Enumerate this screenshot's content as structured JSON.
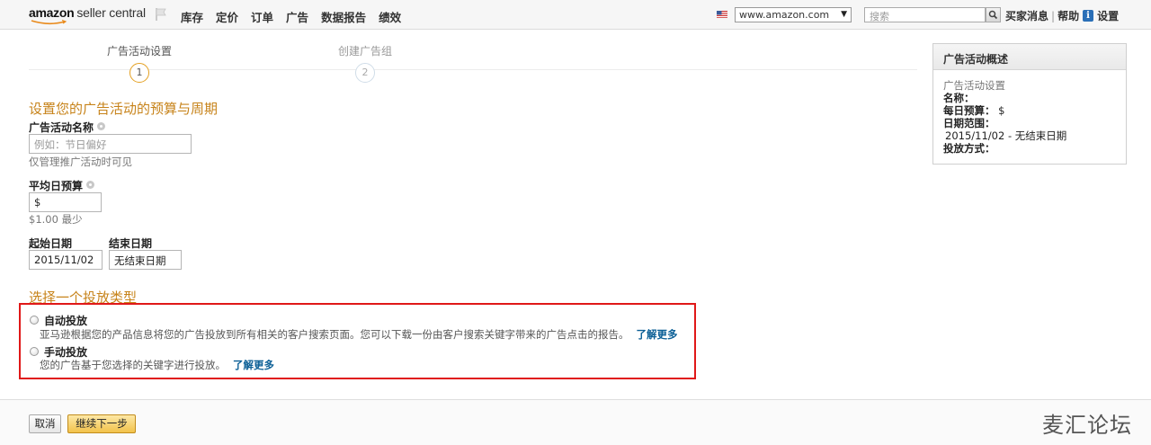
{
  "header": {
    "logo_amazon": "amazon",
    "logo_product": "seller central",
    "nav": [
      "库存",
      "定价",
      "订单",
      "广告",
      "数据报告",
      "绩效"
    ],
    "marketplace": "www.amazon.com",
    "search_placeholder": "搜索",
    "links": {
      "messages": "买家消息",
      "help": "帮助",
      "settings": "设置"
    }
  },
  "steps": [
    {
      "label": "广告活动设置",
      "number": "1"
    },
    {
      "label": "创建广告组",
      "number": "2"
    }
  ],
  "summary": {
    "title": "广告活动概述",
    "subtitle": "广告活动设置",
    "name_label": "名称：",
    "budget_label": "每日预算：",
    "budget_value": "$",
    "date_label": "日期范围：",
    "date_value": "2015/11/02 - 无结束日期",
    "targeting_label": "投放方式："
  },
  "form": {
    "section_title": "设置您的广告活动的预算与周期",
    "campaign_name_label": "广告活动名称",
    "campaign_name_placeholder": "例如：节日偏好",
    "campaign_name_hint": "仅管理推广活动时可见",
    "budget_label": "平均日预算",
    "budget_value": "$",
    "budget_hint": "$1.00 最少",
    "start_label": "起始日期",
    "start_value": "2015/11/02",
    "end_label": "结束日期",
    "end_value": "无结束日期"
  },
  "targeting": {
    "section_title": "选择一个投放类型",
    "auto_label": "自动投放",
    "auto_desc": "亚马逊根据您的产品信息将您的广告投放到所有相关的客户搜索页面。您可以下载一份由客户搜索关键字带来的广告点击的报告。",
    "manual_label": "手动投放",
    "manual_desc": "您的广告基于您选择的关键字进行投放。",
    "learn_more": "了解更多"
  },
  "footer": {
    "cancel": "取消",
    "continue": "继续下一步"
  },
  "watermark": "麦汇论坛"
}
